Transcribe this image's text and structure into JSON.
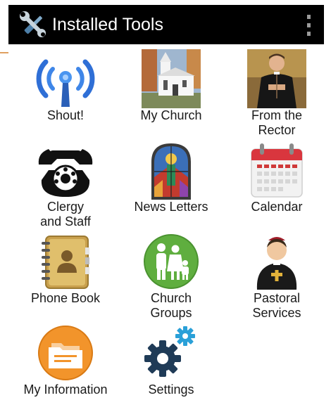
{
  "appbar": {
    "title": "Installed Tools",
    "icon": "wrench-screwdriver-icon",
    "overflow_icon": "overflow-menu-icon"
  },
  "tiles": [
    {
      "label": "Shout!",
      "icon": "broadcast-antenna-icon"
    },
    {
      "label": "My Church",
      "icon": "church-photo-icon"
    },
    {
      "label": "From the\nRector",
      "icon": "rector-photo-icon"
    },
    {
      "label": "Clergy\nand Staff",
      "icon": "rotary-phone-icon"
    },
    {
      "label": "News Letters",
      "icon": "stained-glass-icon"
    },
    {
      "label": "Calendar",
      "icon": "calendar-icon"
    },
    {
      "label": "Phone Book",
      "icon": "address-book-icon"
    },
    {
      "label": "Church\nGroups",
      "icon": "family-group-icon"
    },
    {
      "label": "Pastoral\nServices",
      "icon": "priest-avatar-icon"
    },
    {
      "label": "My Information",
      "icon": "folder-info-icon"
    },
    {
      "label": "Settings",
      "icon": "gears-icon"
    }
  ],
  "colors": {
    "appbar_bg": "#000000",
    "antenna_blue": "#2f6fd6",
    "settings_dark": "#1f3b57",
    "settings_light": "#2aa0d8",
    "group_green": "#5fae3f",
    "info_orange": "#f2942b",
    "calendar_red": "#d9363e"
  }
}
